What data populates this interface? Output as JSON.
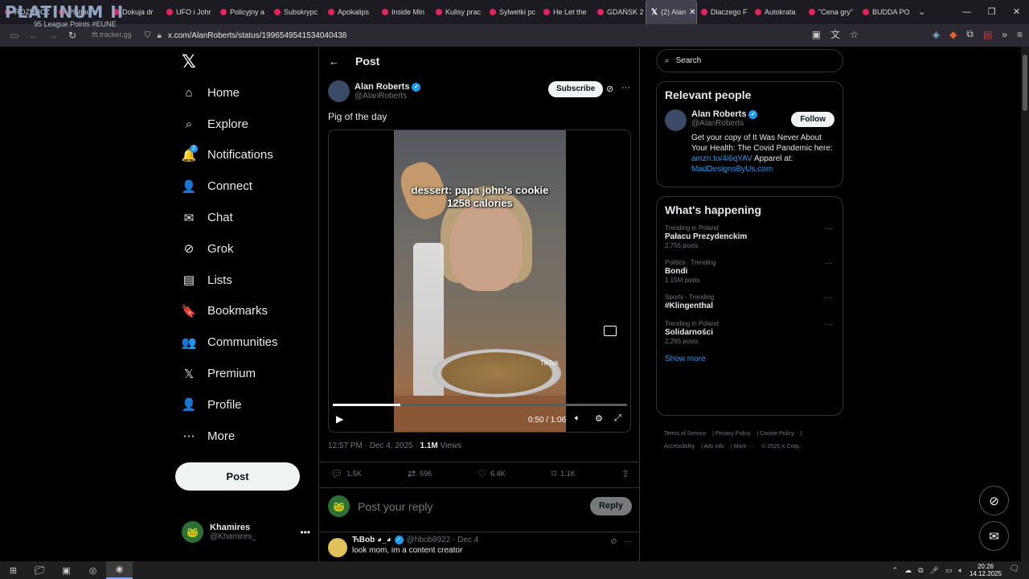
{
  "browser": {
    "tabs": [
      {
        "label": "ROZPOCZ"
      },
      {
        "label": "Platinum"
      },
      {
        "label": "Dokuja dr"
      },
      {
        "label": "UFO i Johr"
      },
      {
        "label": "Policyjny a"
      },
      {
        "label": "Subskrypc"
      },
      {
        "label": "Apokalips"
      },
      {
        "label": "Inside Min"
      },
      {
        "label": "Kulisy prac"
      },
      {
        "label": "Sylwetki pc"
      },
      {
        "label": "He Let the"
      },
      {
        "label": "GDAŃSK 2"
      },
      {
        "label": "(2) Alan",
        "active": true
      },
      {
        "label": "Dlaczego F"
      },
      {
        "label": "Autokrata"
      },
      {
        "label": "\"Cena gry\""
      },
      {
        "label": "BUDDA PO"
      }
    ],
    "url": "x.com/AlanRoberts/status/1996549541534040438",
    "window_controls": [
      "—",
      "❐",
      "✕"
    ]
  },
  "overlay": {
    "rank": "PLATINUM II",
    "league_points": "95 League Points #EUNE",
    "site": "tft.tracker.gg"
  },
  "sidebar": {
    "logo": "𝕏",
    "items": [
      {
        "label": "Home",
        "icon": "home-icon",
        "glyph": "⌂"
      },
      {
        "label": "Explore",
        "icon": "search-icon",
        "glyph": "⌕"
      },
      {
        "label": "Notifications",
        "icon": "bell-icon",
        "glyph": "🔔",
        "badge": "2"
      },
      {
        "label": "Connect",
        "icon": "person-add-icon",
        "glyph": "👤"
      },
      {
        "label": "Chat",
        "icon": "mail-icon",
        "glyph": "✉"
      },
      {
        "label": "Grok",
        "icon": "grok-icon",
        "glyph": "⊘"
      },
      {
        "label": "Lists",
        "icon": "list-icon",
        "glyph": "▤"
      },
      {
        "label": "Bookmarks",
        "icon": "bookmark-icon",
        "glyph": "🔖"
      },
      {
        "label": "Communities",
        "icon": "communities-icon",
        "glyph": "👥"
      },
      {
        "label": "Premium",
        "icon": "x-logo-icon",
        "glyph": "𝕏"
      },
      {
        "label": "Profile",
        "icon": "profile-icon",
        "glyph": "👤"
      },
      {
        "label": "More",
        "icon": "more-circle-icon",
        "glyph": "⋯"
      }
    ],
    "post_button": "Post",
    "account": {
      "name": "Khamires",
      "handle": "@Khamires_"
    }
  },
  "main": {
    "header_title": "Post",
    "author": {
      "name": "Alan Roberts",
      "handle": "@AlanRoberts"
    },
    "subscribe_label": "Subscribe",
    "post_text": "Pig of the day",
    "video": {
      "caption_line1": "dessert: papa john's cookie",
      "caption_line2": "1258 calories",
      "tiktok_label": "TikTok",
      "timecode": "0:50 / 1:06",
      "progress": 0.23
    },
    "meta": {
      "time": "12:57 PM · Dec 4, 2025 · ",
      "views_count": "1.1M",
      "views_label": " Views"
    },
    "actions": {
      "replies": "1.5K",
      "reposts": "596",
      "likes": "6.4K",
      "bookmarks": "1.1K"
    },
    "reply_placeholder": "Post your reply",
    "reply_button": "Reply",
    "first_reply": {
      "name": "ЋBob ◕_◕",
      "handle": "@hbob8922 · Dec 4",
      "text": "look mom, im a content creator"
    }
  },
  "right": {
    "search_placeholder": "Search",
    "relevant_title": "Relevant people",
    "relevant_person": {
      "name": "Alan Roberts",
      "handle": "@AlanRoberts",
      "follow_label": "Follow",
      "bio_text": "Get your copy of It Was Never About Your Health: The Covid Pandemic here:",
      "bio_link1": "amzn.to/4i6qYAV",
      "bio_mid": " Apparel at:",
      "bio_link2": "MadDesignsByUs.com"
    },
    "happening_title": "What's happening",
    "trends": [
      {
        "context": "Trending in Poland",
        "name": "Pałacu Prezydenckim",
        "count": "2,756 posts"
      },
      {
        "context": "Politics · Trending",
        "name": "Bondi",
        "count": "1.15M posts"
      },
      {
        "context": "Sports · Trending",
        "name": "#Klingenthal",
        "count": ""
      },
      {
        "context": "Trending in Poland",
        "name": "Solidarności",
        "count": "2,265 posts"
      }
    ],
    "show_more": "Show more",
    "footer": [
      "Terms of Service",
      "Privacy Policy",
      "Cookie Policy",
      "Accessibility",
      "Ads info",
      "More ···",
      "© 2025 X Corp."
    ]
  },
  "taskbar": {
    "time": "20:26",
    "date": "14.12.2025"
  },
  "colors": {
    "accent": "#1d9bf0",
    "background": "#000000",
    "border": "#2f3336",
    "secondary_text": "#71767b"
  }
}
